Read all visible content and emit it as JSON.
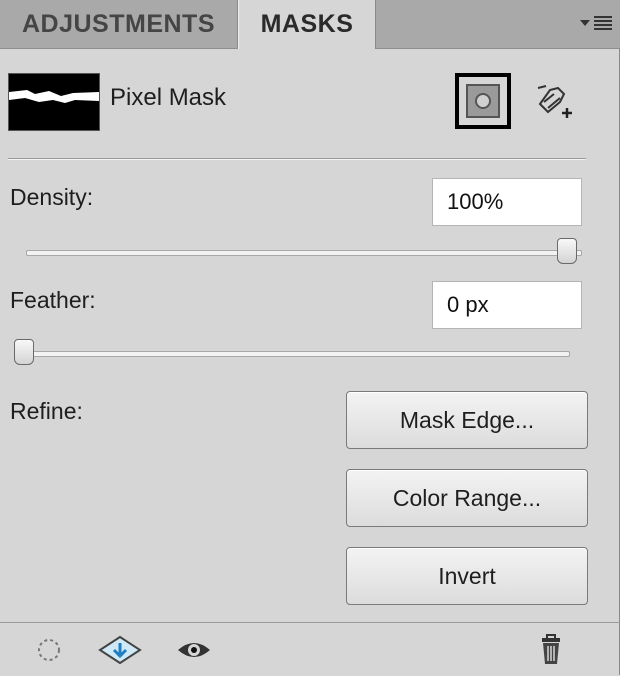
{
  "tabs": [
    {
      "label": "ADJUSTMENTS",
      "active": false
    },
    {
      "label": "MASKS",
      "active": true
    }
  ],
  "header": {
    "mask_type_label": "Pixel Mask",
    "icons": {
      "panel_menu": "panel-menu-icon",
      "pixel_mask": "add-pixel-mask-icon",
      "vector_mask": "add-vector-mask-icon"
    }
  },
  "density": {
    "label": "Density:",
    "value": "100%",
    "slider_fraction": 1.0
  },
  "feather": {
    "label": "Feather:",
    "value": "0 px",
    "slider_fraction": 0.0
  },
  "refine": {
    "label": "Refine:",
    "buttons": [
      "Mask Edge...",
      "Color Range...",
      "Invert"
    ]
  },
  "footer": {
    "icons": [
      "load-selection-icon",
      "apply-mask-icon",
      "visibility-eye-icon",
      "delete-mask-trash-icon"
    ]
  },
  "colors": {
    "panel_bg": "#d6d6d6",
    "tabbar_bg": "#a9a9a9",
    "field_bg": "#ffffff",
    "accent_blue": "#3aa0d8"
  }
}
